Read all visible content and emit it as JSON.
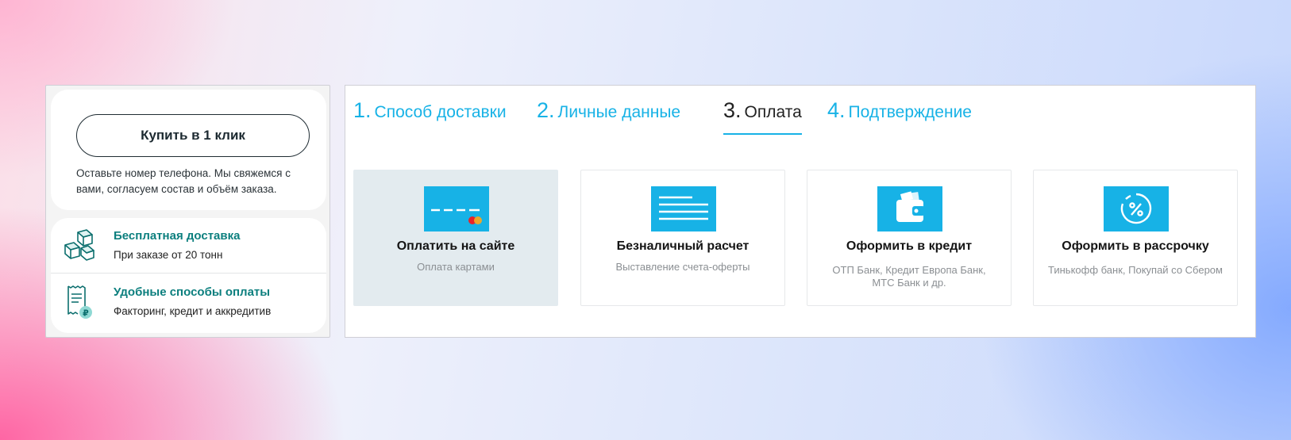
{
  "buy_block": {
    "button_label": "Купить в 1 клик",
    "note": "Оставьте номер телефона. Мы свяжемся с вами, согласуем состав и объём заказа."
  },
  "features": [
    {
      "title": "Бесплатная доставка",
      "subtitle": "При заказе от 20 тонн",
      "icon": "boxes-icon"
    },
    {
      "title": "Удобные способы оплаты",
      "subtitle": "Факторинг, кредит и аккредитив",
      "icon": "receipt-ruble-icon"
    }
  ],
  "steps": [
    {
      "number": "1.",
      "label": "Способ доставки",
      "active": false
    },
    {
      "number": "2.",
      "label": "Личные данные",
      "active": false
    },
    {
      "number": "3.",
      "label": "Оплата",
      "active": true
    },
    {
      "number": "4.",
      "label": "Подтверждение",
      "active": false
    }
  ],
  "payment_options": [
    {
      "title": "Оплатить на сайте",
      "subtitle": "Оплата картами",
      "icon": "credit-card-icon",
      "selected": true
    },
    {
      "title": "Безналичный расчет",
      "subtitle": "Выставление счета-оферты",
      "icon": "invoice-icon",
      "selected": false
    },
    {
      "title": "Оформить в кредит",
      "subtitle": "ОТП Банк, Кредит Европа Банк, МТС Банк и др.",
      "icon": "wallet-icon",
      "selected": false
    },
    {
      "title": "Оформить в рассрочку",
      "subtitle": "Тинькофф банк, Покупай со Сбером",
      "icon": "percent-icon",
      "selected": false
    }
  ],
  "colors": {
    "accent_blue": "#17b2e6",
    "teal_title": "#0c7f7e",
    "selected_card_bg": "#e3ebef"
  }
}
